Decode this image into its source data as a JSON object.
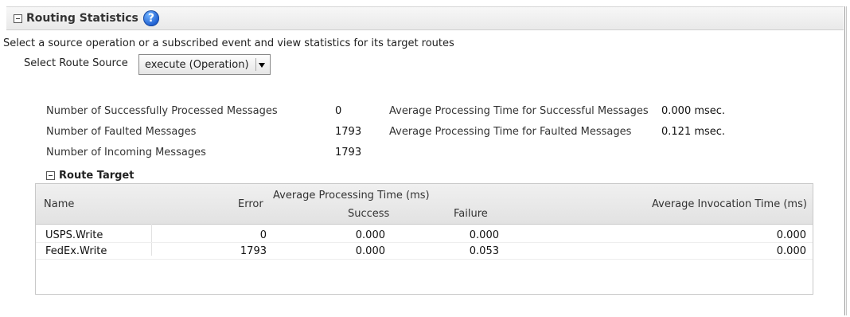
{
  "panel": {
    "title": "Routing Statistics",
    "help_glyph": "?"
  },
  "description": "Select a source operation or a subscribed event and view statistics for its target routes",
  "route_source": {
    "label": "Select Route Source",
    "value": "execute (Operation)"
  },
  "stats": {
    "successful_label": "Number of Successfully Processed Messages",
    "successful_value": "0",
    "faulted_label": "Number of Faulted Messages",
    "faulted_value": "1793",
    "incoming_label": "Number of Incoming Messages",
    "incoming_value": "1793",
    "avg_success_label": "Average Processing Time for Successful Messages",
    "avg_success_value": "0.000 msec.",
    "avg_fault_label": "Average Processing Time for Faulted Messages",
    "avg_fault_value": "0.121 msec."
  },
  "route_target": {
    "title": "Route Target",
    "headers": {
      "name": "Name",
      "error": "Error",
      "avg_processing": "Average Processing Time (ms)",
      "success": "Success",
      "failure": "Failure",
      "avg_invocation": "Average Invocation Time (ms)"
    },
    "rows": [
      {
        "name": "USPS.Write",
        "error": "0",
        "success": "0.000",
        "failure": "0.000",
        "invocation": "0.000"
      },
      {
        "name": "FedEx.Write",
        "error": "1793",
        "success": "0.000",
        "failure": "0.053",
        "invocation": "0.000"
      }
    ]
  },
  "icons": {
    "collapse": "collapse-minus-icon",
    "help": "help-icon",
    "dropdown": "dropdown-arrow-icon"
  }
}
